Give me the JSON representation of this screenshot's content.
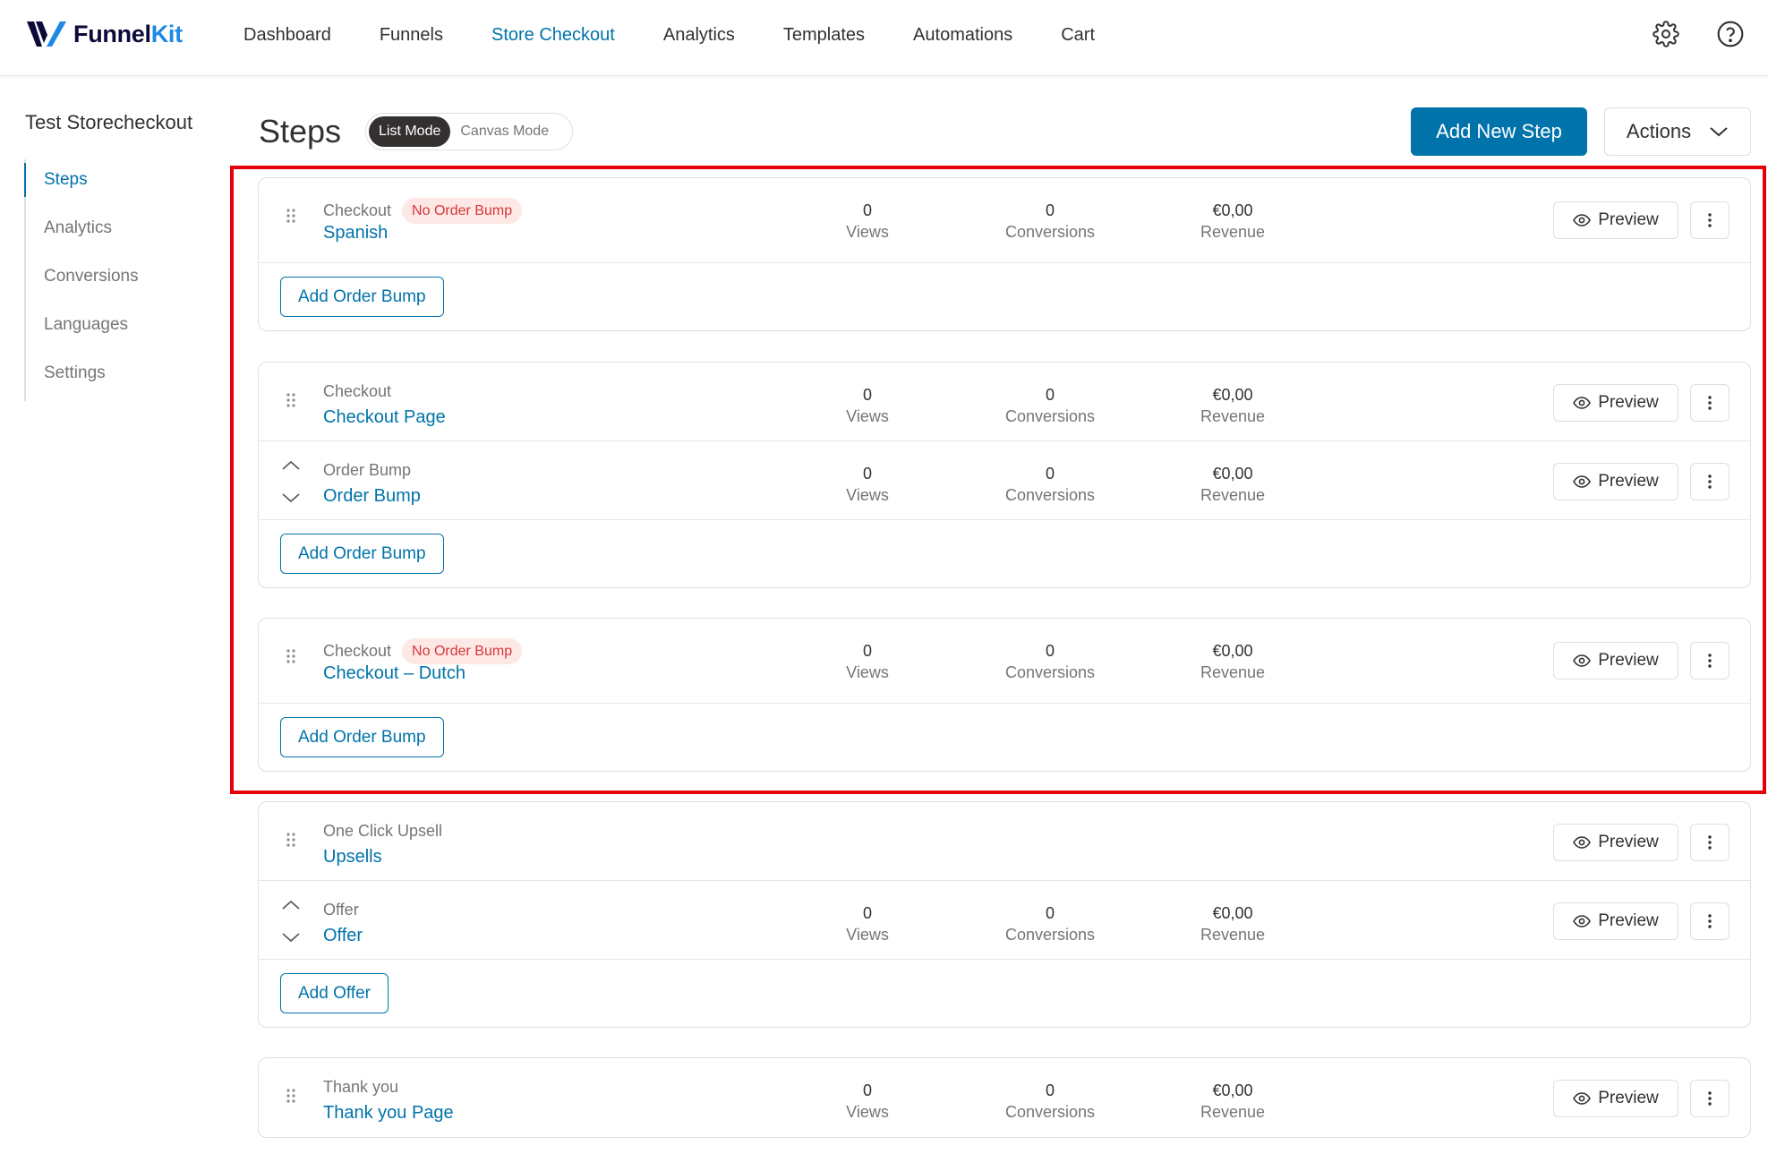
{
  "app": {
    "logo_main": "Funnel",
    "logo_accent": "Kit"
  },
  "nav": {
    "items": [
      {
        "label": "Dashboard"
      },
      {
        "label": "Funnels"
      },
      {
        "label": "Store Checkout"
      },
      {
        "label": "Analytics"
      },
      {
        "label": "Templates"
      },
      {
        "label": "Automations"
      },
      {
        "label": "Cart"
      }
    ],
    "active": "Store Checkout"
  },
  "sidebar": {
    "funnel_name": "Test Storecheckout",
    "items": [
      {
        "label": "Steps"
      },
      {
        "label": "Analytics"
      },
      {
        "label": "Conversions"
      },
      {
        "label": "Languages"
      },
      {
        "label": "Settings"
      }
    ],
    "active": "Steps"
  },
  "header": {
    "title": "Steps",
    "list_mode": "List Mode",
    "canvas_mode": "Canvas Mode",
    "add_step": "Add New Step",
    "actions": "Actions"
  },
  "labels": {
    "views": "Views",
    "conversions": "Conversions",
    "revenue": "Revenue",
    "preview": "Preview"
  },
  "cards": [
    {
      "rows": [
        {
          "type": "Checkout",
          "badge": "No Order Bump",
          "name": "Spanish",
          "views": "0",
          "conversions": "0",
          "revenue": "€0,00"
        }
      ],
      "add_button": "Add Order Bump"
    },
    {
      "rows": [
        {
          "type": "Checkout",
          "name": "Checkout Page",
          "views": "0",
          "conversions": "0",
          "revenue": "€0,00"
        },
        {
          "type": "Order Bump",
          "name": "Order Bump",
          "views": "0",
          "conversions": "0",
          "revenue": "€0,00"
        }
      ],
      "add_button": "Add Order Bump"
    },
    {
      "rows": [
        {
          "type": "Checkout",
          "badge": "No Order Bump",
          "name": "Checkout – Dutch",
          "views": "0",
          "conversions": "0",
          "revenue": "€0,00"
        }
      ],
      "add_button": "Add Order Bump"
    },
    {
      "rows": [
        {
          "type": "One Click Upsell",
          "name": "Upsells"
        },
        {
          "type": "Offer",
          "name": "Offer",
          "views": "0",
          "conversions": "0",
          "revenue": "€0,00"
        }
      ],
      "add_button": "Add Offer"
    },
    {
      "rows": [
        {
          "type": "Thank you",
          "name": "Thank you Page",
          "views": "0",
          "conversions": "0",
          "revenue": "€0,00"
        }
      ]
    }
  ],
  "colors": {
    "accent": "#0073aa",
    "badge_bg": "#fde8e6",
    "badge_text": "#d63638",
    "highlight": "#e5000b"
  }
}
